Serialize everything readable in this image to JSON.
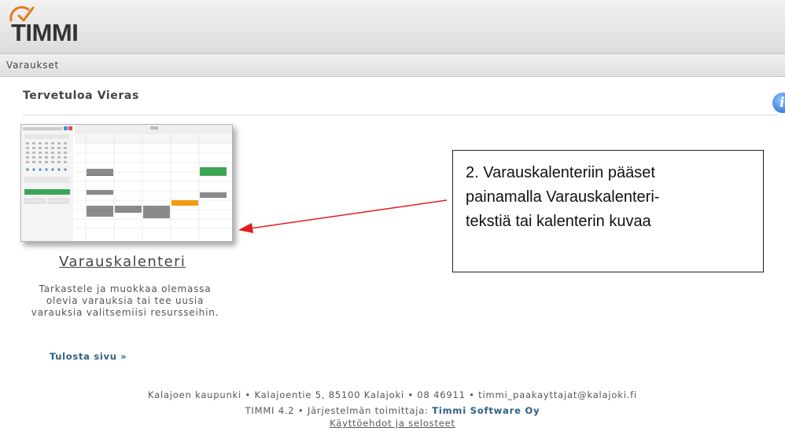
{
  "app": {
    "logo_text": "TIMMI"
  },
  "nav": {
    "items": [
      {
        "label": "Varaukset"
      }
    ]
  },
  "page": {
    "title": "Tervetuloa  Vieras",
    "info_icon": "i"
  },
  "calendar_card": {
    "link_label": "Varauskalenteri",
    "description_lines": [
      "Tarkastele ja muokkaa olemassa",
      "olevia varauksia tai tee uusia",
      "varauksia valitsemiisi resursseihin."
    ]
  },
  "print": {
    "label": "Tulosta sivu »"
  },
  "footer": {
    "line1": "Kalajoen kaupunki • Kalajoentie 5, 85100 Kalajoki • 08 46911 • timmi_paakayttajat@kalajoki.fi",
    "line2_prefix": "TIMMI 4.2 • Järjestelmän toimittaja: ",
    "vendor": "Timmi Software Oy",
    "terms": "Käyttöehdot ja selosteet"
  },
  "annotation": {
    "lines": [
      "2. Varauskalenteriin pääset",
      "painamalla Varauskalenteri-",
      "tekstiä tai kalenterin kuvaa"
    ]
  },
  "colors": {
    "link_blue": "#2b5f86",
    "arrow_red": "#e31b1b",
    "thumb_green": "#3aa655",
    "thumb_orange": "#f39c12"
  },
  "icons": [
    "timmi-logo-icon",
    "info-icon",
    "arrow-icon"
  ]
}
